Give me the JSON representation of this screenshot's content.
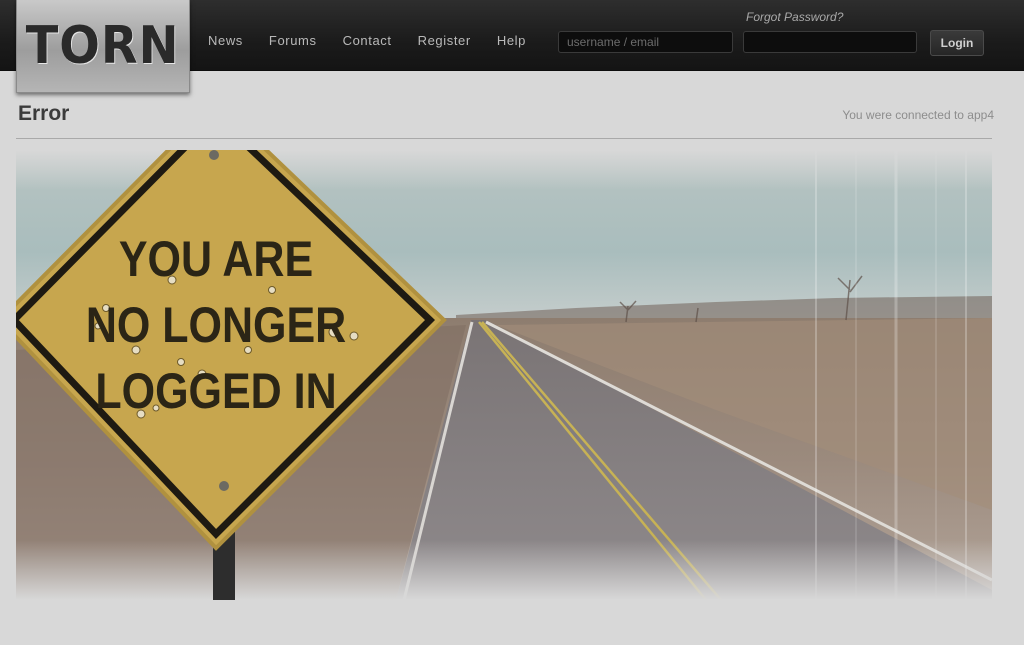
{
  "header": {
    "logo_text": "TORN",
    "nav": [
      "News",
      "Forums",
      "Contact",
      "Register",
      "Help"
    ],
    "forgot_password": "Forgot Password?",
    "username_placeholder": "username / email",
    "login_label": "Login"
  },
  "main": {
    "title": "Error",
    "connection": "You were connected to app4",
    "sign_lines": [
      "YOU ARE",
      "NO LONGER",
      "LOGGED IN"
    ]
  },
  "colors": {
    "topbar": "#1e1e1e",
    "background": "#d8d8d8",
    "sign_yellow": "#c7a64e",
    "sign_border": "#1e1a12"
  }
}
